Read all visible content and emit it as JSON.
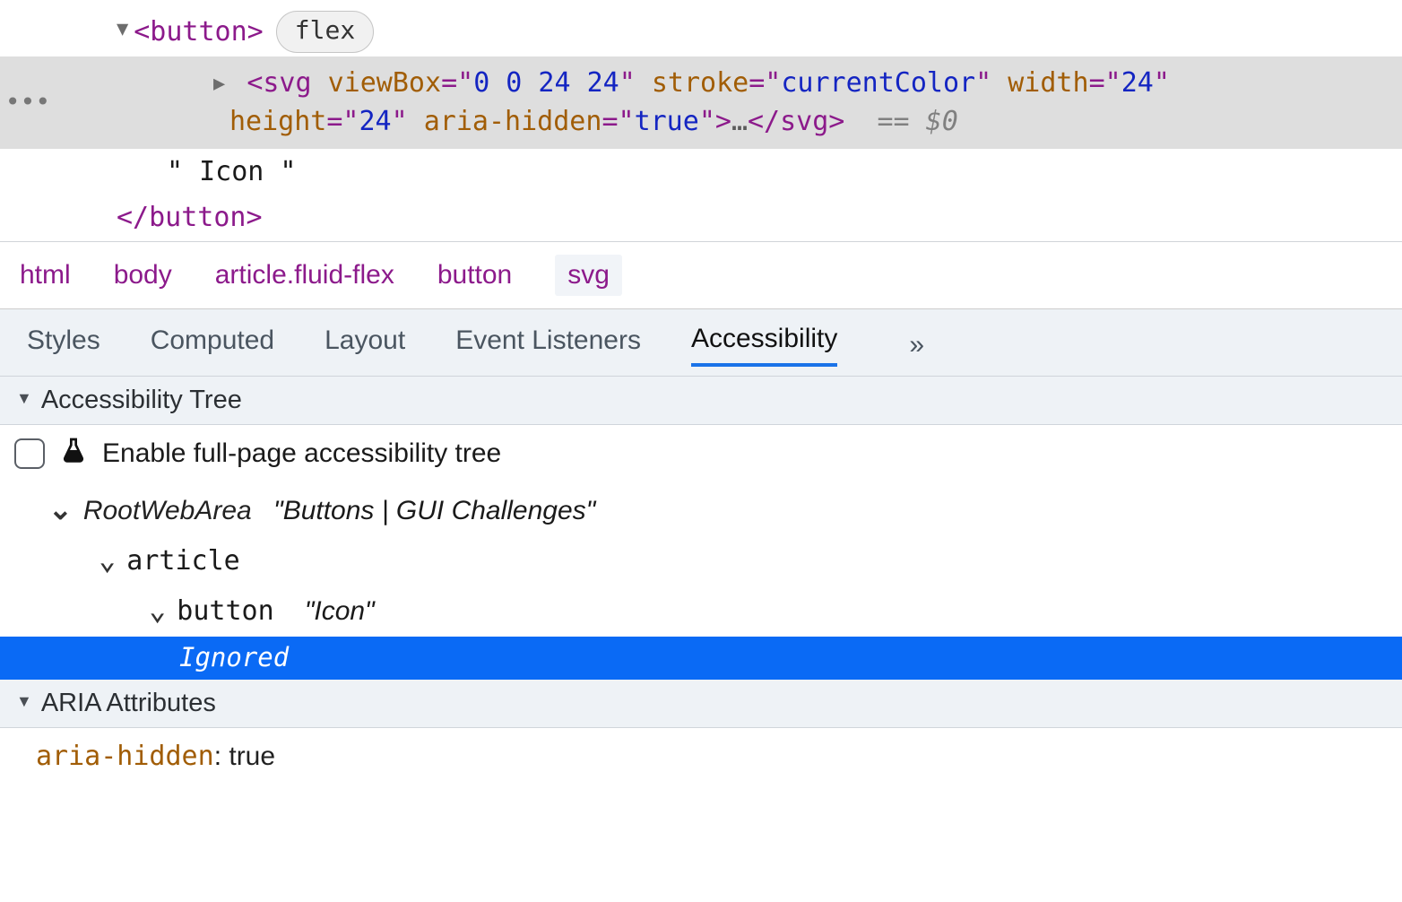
{
  "dom": {
    "button_open": "<button>",
    "button_close": "</button>",
    "flex_badge": "flex",
    "svg_tag": "svg",
    "svg_attrs": {
      "viewBox_name": "viewBox",
      "viewBox_val": "0 0 24 24",
      "stroke_name": "stroke",
      "stroke_val": "currentColor",
      "width_name": "width",
      "width_val": "24",
      "height_name": "height",
      "height_val": "24",
      "aria_hidden_name": "aria-hidden",
      "aria_hidden_val": "true"
    },
    "svg_ellipsis": "…",
    "svg_close": "</svg>",
    "eq_dollar": "== $0",
    "text_node": "\" Icon \"",
    "gutter_dots": "•••"
  },
  "breadcrumb": [
    "html",
    "body",
    "article.fluid-flex",
    "button",
    "svg"
  ],
  "tabs": [
    "Styles",
    "Computed",
    "Layout",
    "Event Listeners",
    "Accessibility"
  ],
  "tabs_more": "»",
  "sections": {
    "acc_tree": "Accessibility Tree",
    "aria_attrs": "ARIA Attributes"
  },
  "enable_full_tree": "Enable full-page accessibility tree",
  "tree": {
    "root_role": "RootWebArea",
    "root_name": "\"Buttons | GUI Challenges\"",
    "article_role": "article",
    "button_role": "button",
    "button_name": "\"Icon\"",
    "ignored": "Ignored"
  },
  "aria": {
    "key": "aria-hidden",
    "sep": ": ",
    "val": "true"
  }
}
